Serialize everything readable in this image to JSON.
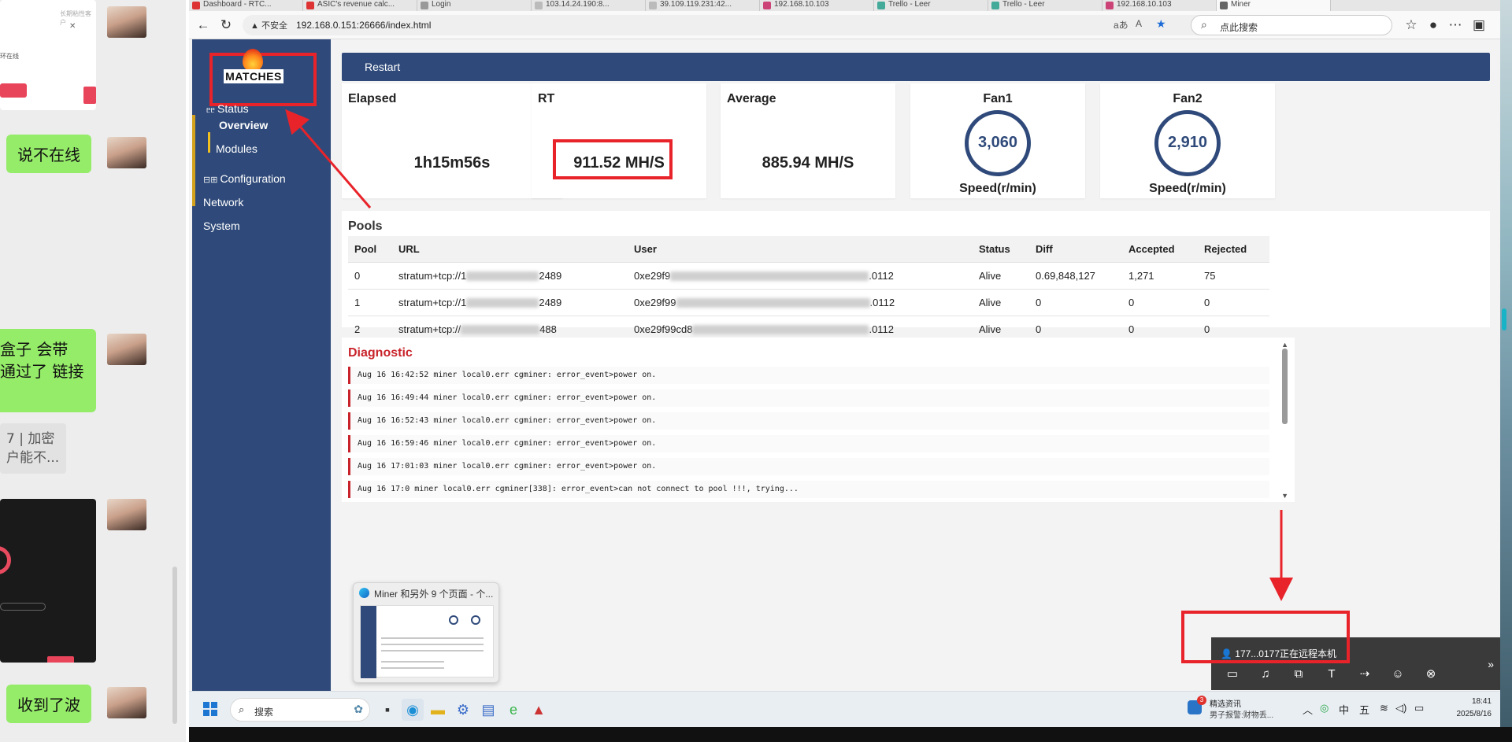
{
  "chat": {
    "card": {
      "text_top": "长期粘性客户",
      "text_mid": "环在线"
    },
    "messages": [
      {
        "text": "说不在线"
      },
      {
        "line1": "盒子 会带",
        "line2": "通过了 链接"
      },
      {
        "line1": "7 | 加密",
        "line2": "户能不..."
      },
      {
        "text": "收到了波"
      }
    ]
  },
  "browser": {
    "tabs": [
      {
        "label": "Dashboard - RTC..."
      },
      {
        "label": "ASIC's revenue calc..."
      },
      {
        "label": "Login"
      },
      {
        "label": "103.14.24.190:8..."
      },
      {
        "label": "39.109.119.231:42..."
      },
      {
        "label": "192.168.10.103"
      },
      {
        "label": "Trello - Leer"
      },
      {
        "label": "Trello - Leer"
      },
      {
        "label": "192.168.10.103"
      },
      {
        "label": "Miner"
      }
    ],
    "security_label": "不安全",
    "url": "192.168.0.151:26666/index.html",
    "search_placeholder": "点此搜索",
    "icons": {
      "back": "back-icon",
      "refresh": "refresh-icon",
      "favorite": "star-icon",
      "menu": "more-icon"
    }
  },
  "app": {
    "logo_text": "MATCHES",
    "nav": {
      "status": {
        "prefix": "ᥱᥱ",
        "label": "Status"
      },
      "overview": "Overview",
      "modules": "Modules",
      "configuration": {
        "prefix": "⊟⊞",
        "label": "Configuration"
      },
      "network": "Network",
      "system": "System"
    },
    "restart_label": "Restart",
    "cards": {
      "elapsed": {
        "title": "Elapsed",
        "value": "1h15m56s"
      },
      "rt": {
        "title": "RT",
        "value": "911.52 MH/S"
      },
      "average": {
        "title": "Average",
        "value": "885.94 MH/S"
      },
      "fan1": {
        "title": "Fan1",
        "value": "3,060",
        "unit": "Speed(r/min)"
      },
      "fan2": {
        "title": "Fan2",
        "value": "2,910",
        "unit": "Speed(r/min)"
      }
    },
    "pools": {
      "title": "Pools",
      "headers": {
        "pool": "Pool",
        "url": "URL",
        "user": "User",
        "status": "Status",
        "diff": "Diff",
        "accepted": "Accepted",
        "rejected": "Rejected"
      },
      "rows": [
        {
          "pool": "0",
          "url_a": "stratum+tcp://1",
          "url_b": "2489",
          "user_a": "0xe29f9",
          "user_b": ".0112",
          "status": "Alive",
          "diff": "0.69,848,127",
          "accepted": "1,271",
          "rejected": "75"
        },
        {
          "pool": "1",
          "url_a": "stratum+tcp://1",
          "url_b": "2489",
          "user_a": "0xe29f99",
          "user_b": ".0112",
          "status": "Alive",
          "diff": "0",
          "accepted": "0",
          "rejected": "0"
        },
        {
          "pool": "2",
          "url_a": "stratum+tcp://",
          "url_b": "488",
          "user_a": "0xe29f99cd8",
          "user_b": ".0112",
          "status": "Alive",
          "diff": "0",
          "accepted": "0",
          "rejected": "0"
        }
      ]
    },
    "diagnostic": {
      "title": "Diagnostic",
      "logs": [
        "Aug 16 16:42:52 miner local0.err cgminer: error_event>power on.",
        "Aug 16 16:49:44 miner local0.err cgminer: error_event>power on.",
        "Aug 16 16:52:43 miner local0.err cgminer: error_event>power on.",
        "Aug 16 16:59:46 miner local0.err cgminer: error_event>power on.",
        "Aug 16 17:01:03 miner local0.err cgminer: error_event>power on.",
        "Aug 16 17:0  miner local0.err cgminer[338]: error_event>can not connect to pool !!!, trying..."
      ]
    }
  },
  "preview": {
    "title": "Miner 和另外 9 个页面 - 个..."
  },
  "remote": {
    "text": "177...0177正在远程本机"
  },
  "taskbar": {
    "search_placeholder": "搜索",
    "news_title": "精选资讯",
    "news_sub": "男子报警:财物丢...",
    "news_badge": "3",
    "ime_lang": "中",
    "ime_mode": "五",
    "time": "18:41",
    "date": "2025/8/16"
  }
}
